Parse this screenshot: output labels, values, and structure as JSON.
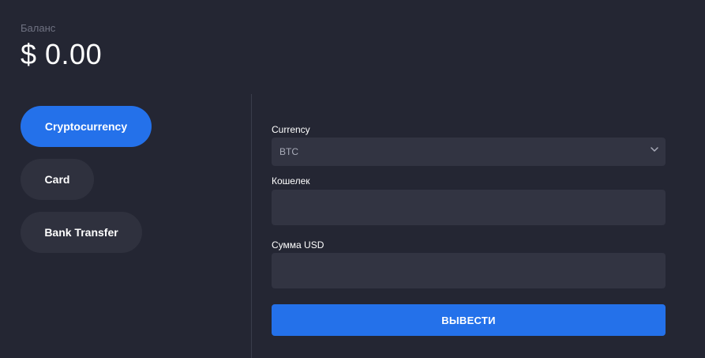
{
  "balance": {
    "label": "Баланс",
    "value": "$ 0.00"
  },
  "methods": {
    "items": [
      {
        "label": "Cryptocurrency",
        "active": true
      },
      {
        "label": "Card",
        "active": false
      },
      {
        "label": "Bank Transfer",
        "active": false
      }
    ]
  },
  "form": {
    "currency": {
      "label": "Currency",
      "value": "BTC",
      "icon": "chevron-down-icon"
    },
    "wallet": {
      "label": "Кошелек",
      "value": ""
    },
    "amount": {
      "label": "Сумма USD",
      "value": ""
    },
    "submit_label": "ВЫВЕСТИ"
  },
  "colors": {
    "background": "#242633",
    "field": "#323442",
    "accent": "#2471ea",
    "pill": "#2f313e"
  }
}
